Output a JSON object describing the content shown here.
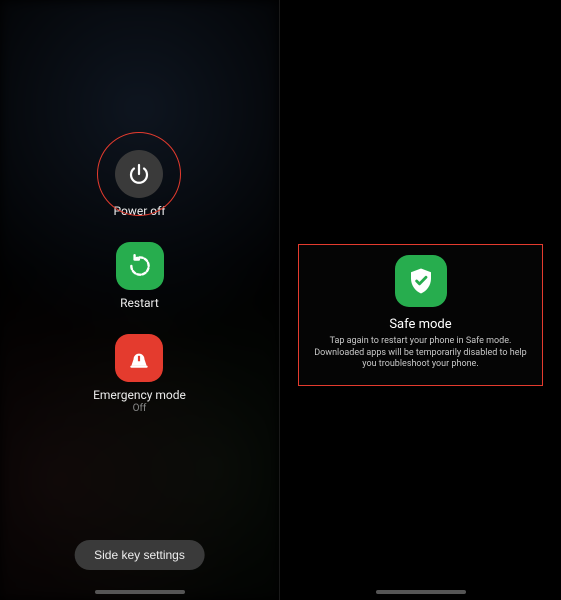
{
  "left": {
    "power_off": {
      "label": "Power off"
    },
    "restart": {
      "label": "Restart"
    },
    "emergency": {
      "label": "Emergency mode",
      "sublabel": "Off"
    },
    "side_key": {
      "label": "Side key settings"
    }
  },
  "right": {
    "safe_mode": {
      "title": "Safe mode",
      "desc": "Tap again to restart your phone in Safe mode. Downloaded apps will be temporarily disabled to help you troubleshoot your phone."
    }
  },
  "colors": {
    "accent_green": "#27ad4e",
    "accent_red": "#e43b2e",
    "icon_dark": "#3a3a3a"
  }
}
